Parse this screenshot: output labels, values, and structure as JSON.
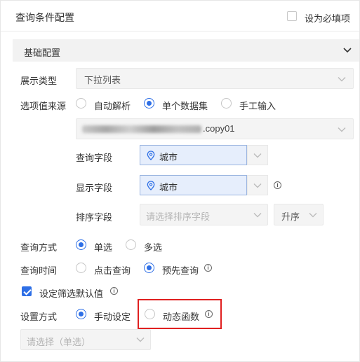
{
  "header": {
    "title": "查询条件配置",
    "required_label": "设为必填项"
  },
  "section": {
    "title": "基础配置"
  },
  "display_type": {
    "label": "展示类型",
    "value": "下拉列表"
  },
  "option_source": {
    "label": "选项值来源",
    "options": [
      "自动解析",
      "单个数据集",
      "手工输入"
    ],
    "selected": "单个数据集",
    "dataset_suffix": ".copy01"
  },
  "query_field": {
    "label": "查询字段",
    "value": "城市"
  },
  "display_field": {
    "label": "显示字段",
    "value": "城市"
  },
  "sort_field": {
    "label": "排序字段",
    "placeholder": "请选择排序字段",
    "order": "升序"
  },
  "query_mode": {
    "label": "查询方式",
    "options": [
      "单选",
      "多选"
    ],
    "selected": "单选"
  },
  "query_time": {
    "label": "查询时间",
    "options": [
      "点击查询",
      "预先查询"
    ],
    "selected": "预先查询"
  },
  "default_value": {
    "label": "设定筛选默认值",
    "checked": true
  },
  "set_mode": {
    "label": "设置方式",
    "options": [
      "手动设定",
      "动态函数"
    ],
    "selected": "手动设定"
  },
  "bottom_select": {
    "placeholder": "请选择（单选）"
  },
  "colors": {
    "accent": "#2e6fe6",
    "highlight": "#e02020"
  }
}
